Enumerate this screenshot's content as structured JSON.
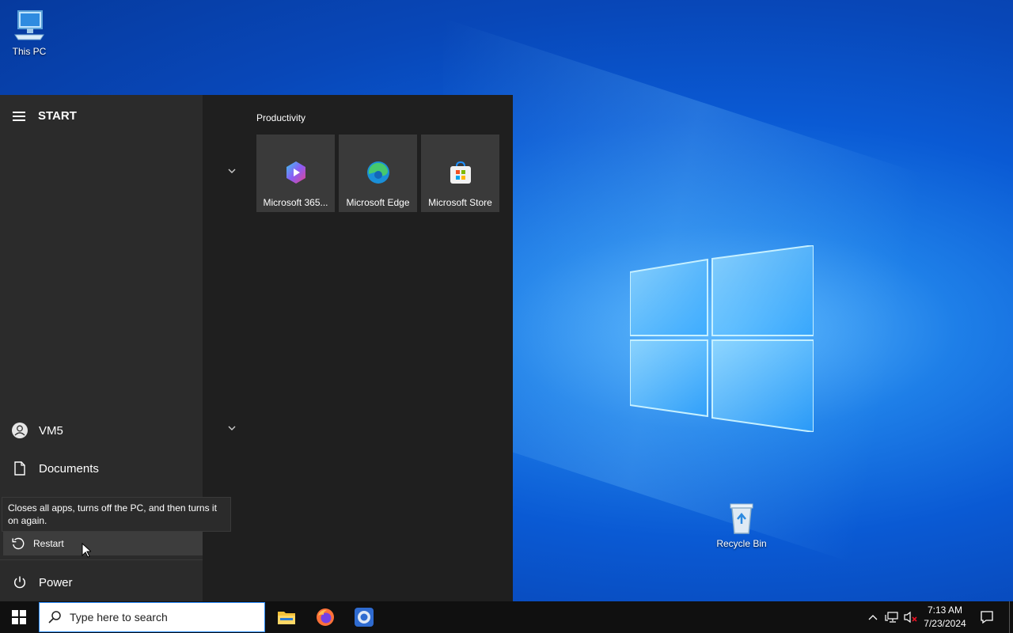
{
  "desktop": {
    "icons": [
      {
        "label": "This PC"
      },
      {
        "label": "Recycle Bin"
      }
    ]
  },
  "start_menu": {
    "header": "START",
    "left_items": [
      {
        "label": "VM5",
        "icon": "user-icon"
      },
      {
        "label": "Documents",
        "icon": "document-icon"
      }
    ],
    "tooltip": "Closes all apps, turns off the PC, and then turns it on again.",
    "restart_label": "Restart",
    "power_label": "Power",
    "group_title": "Productivity",
    "tiles": [
      {
        "label": "Microsoft 365...",
        "icon": "microsoft-365-icon"
      },
      {
        "label": "Microsoft Edge",
        "icon": "edge-icon"
      },
      {
        "label": "Microsoft Store",
        "icon": "store-icon"
      }
    ]
  },
  "taskbar": {
    "search_placeholder": "Type here to search",
    "apps": [
      "file-explorer-icon",
      "firefox-icon",
      "chrome-icon"
    ],
    "time": "7:13 AM",
    "date": "7/23/2024"
  },
  "colors": {
    "accent": "#0a5ad4",
    "start_bg": "#1f1f1f",
    "taskbar_bg": "#101010"
  }
}
